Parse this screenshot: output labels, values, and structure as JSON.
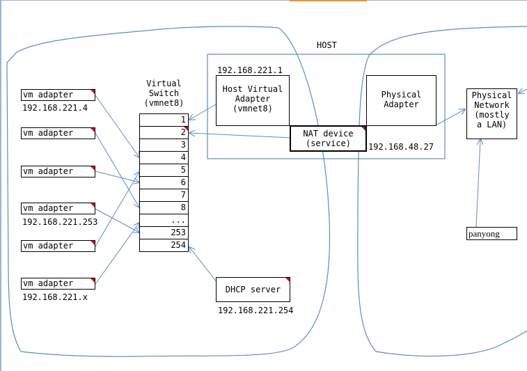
{
  "diagram": {
    "host_label": "HOST",
    "vm_adapters": [
      {
        "label": "vm adapter",
        "ip": "192.168.221.4"
      },
      {
        "label": "vm adapter",
        "ip": ""
      },
      {
        "label": "vm adapter",
        "ip": ""
      },
      {
        "label": "vm adapter",
        "ip": "192.168.221.253"
      },
      {
        "label": "vm adapter",
        "ip": ""
      },
      {
        "label": "vm adapter",
        "ip": "192.168.221.x"
      }
    ],
    "virtual_switch": {
      "title_lines": [
        "Virtual",
        "Switch",
        "(vmnet8)"
      ],
      "ports": [
        "1",
        "2",
        "3",
        "4",
        "5",
        "6",
        "7",
        "8",
        "...",
        "253",
        "254"
      ]
    },
    "host_virtual_adapter": {
      "ip": "192.168.221.1",
      "lines": [
        "Host Virtual",
        "Adapter",
        "(vmnet8)"
      ]
    },
    "nat_device": {
      "lines": [
        "NAT device",
        "(service)"
      ]
    },
    "physical_adapter": {
      "lines": [
        "Physical",
        "Adapter"
      ],
      "ip": "192.168.48.27"
    },
    "physical_network": {
      "lines": [
        "Physical",
        "Network",
        "(mostly",
        "a LAN)"
      ]
    },
    "dhcp_server": {
      "label": "DHCP server",
      "ip": "192.168.221.254"
    },
    "client": {
      "label": "panyong"
    },
    "colors": {
      "connector": "#5b8bc9",
      "box_border": "#000000",
      "marker": "#e00000",
      "accent_bar": "#f0922e"
    }
  }
}
